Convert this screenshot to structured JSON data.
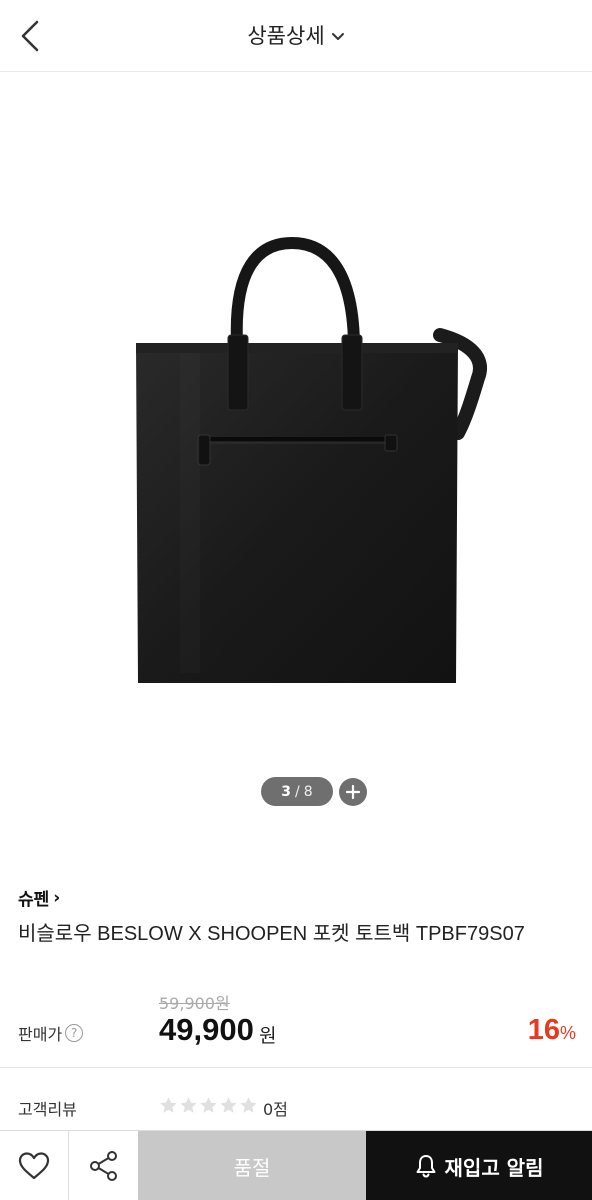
{
  "header": {
    "title": "상품상세",
    "back_icon": "chevron-left-icon",
    "dropdown_icon": "chevron-down-icon"
  },
  "gallery": {
    "current": "3",
    "separator": "/",
    "total": "8",
    "zoom_icon": "plus-icon"
  },
  "product": {
    "brand": "슈펜",
    "brand_arrow": "›",
    "name": "비슬로우 BESLOW X SHOOPEN 포켓 토트백 TPBF79S07",
    "original_price": "59,900원",
    "price_label": "판매가",
    "help_icon": "?",
    "price": "49,900",
    "price_unit": "원",
    "discount": "16",
    "discount_unit": "%",
    "discount_color": "#e8391f"
  },
  "review": {
    "label": "고객리뷰",
    "rating": 0,
    "max_rating": 5,
    "score": "0점"
  },
  "bottom_bar": {
    "wish_icon": "heart-icon",
    "share_icon": "share-icon",
    "soldout_label": "품절",
    "restock_label": "재입고 알림",
    "restock_icon": "bell-icon"
  }
}
